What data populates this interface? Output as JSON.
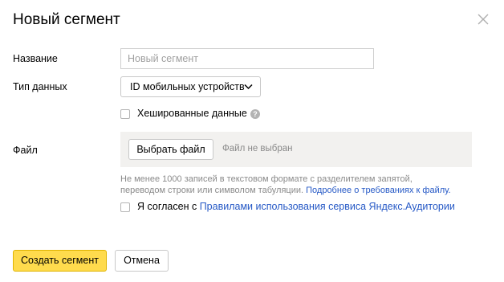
{
  "dialog": {
    "title": "Новый сегмент"
  },
  "form": {
    "name_label": "Название",
    "name_placeholder": "Новый сегмент",
    "name_value": "",
    "type_label": "Тип данных",
    "type_selected": "ID мобильных устройств",
    "hashed_label": "Хешированные данные",
    "hashed_checked": false,
    "help_glyph": "?",
    "file_label": "Файл",
    "file_button": "Выбрать файл",
    "file_status": "Файл не выбран",
    "hint_line1": "Не менее 1000 записей в текстовом формате с разделителем запятой,",
    "hint_line2": "переводом строки или символом табуляции.",
    "hint_link": "Подробнее о требованиях к файлу.",
    "agree_prefix": "Я согласен с",
    "agree_link": "Правилами использования сервиса Яндекс.Аудитории",
    "agree_checked": false
  },
  "footer": {
    "create_button": "Создать сегмент",
    "cancel_button": "Отмена"
  },
  "icons": {
    "close": "close-icon",
    "chevron": "chevron-down-icon",
    "help": "question-icon"
  },
  "colors": {
    "primary_button": "#ffdb4d",
    "link": "#2659c6",
    "file_area_bg": "#f2f1ef",
    "muted_text": "#8a8a8a"
  }
}
